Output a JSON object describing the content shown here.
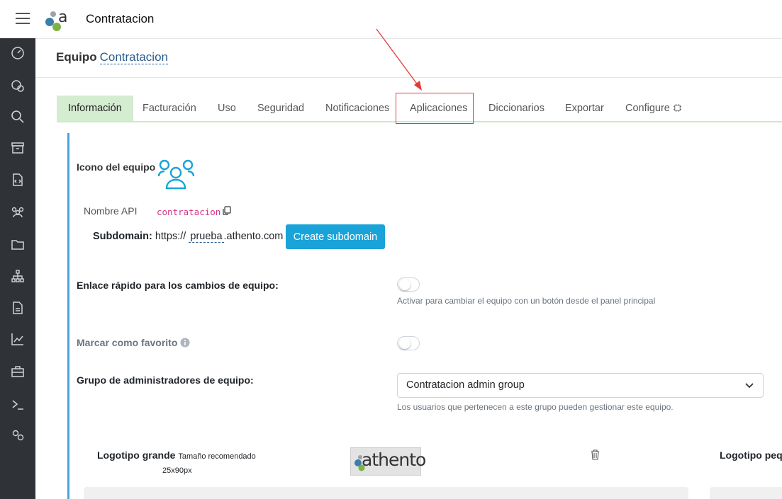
{
  "topbar": {
    "app_title": "Contratacion"
  },
  "header": {
    "prefix": "Equipo",
    "team_name": "Contratacion"
  },
  "tabs": [
    {
      "label": "Información"
    },
    {
      "label": "Facturación"
    },
    {
      "label": "Uso"
    },
    {
      "label": "Seguridad"
    },
    {
      "label": "Notificaciones"
    },
    {
      "label": "Aplicaciones"
    },
    {
      "label": "Diccionarios"
    },
    {
      "label": "Exportar"
    },
    {
      "label": "Configure"
    }
  ],
  "info": {
    "team_icon_label": "Icono del equipo",
    "api_name_label": "Nombre API",
    "api_name_value": "contratacion",
    "subdomain_label": "Subdomain:",
    "subdomain_prefix": "https://",
    "subdomain_value": "prueba",
    "subdomain_suffix": ".athento.com",
    "create_subdomain_button": "Create subdomain",
    "quick_link_label": "Enlace rápido para los cambios de equipo:",
    "quick_link_help": "Activar para cambiar el equipo con un botón desde el panel principal",
    "favorite_label": "Marcar como favorito",
    "admin_group_label": "Grupo de administradores de equipo:",
    "admin_group_value": "Contratacion admin group",
    "admin_group_help": "Los usuarios que pertenecen a este grupo pueden gestionar este equipo.",
    "big_logo_label": "Logotipo grande",
    "big_logo_hint": "Tamaño recomendado",
    "big_logo_size": "25x90px",
    "big_logo_text": "athento",
    "small_logo_label": "Logotipo peq"
  },
  "colors": {
    "accent": "#1aa3d9",
    "sidebar": "#2f3338",
    "active_tab": "#d4ecd0",
    "annotation": "#e53935"
  }
}
